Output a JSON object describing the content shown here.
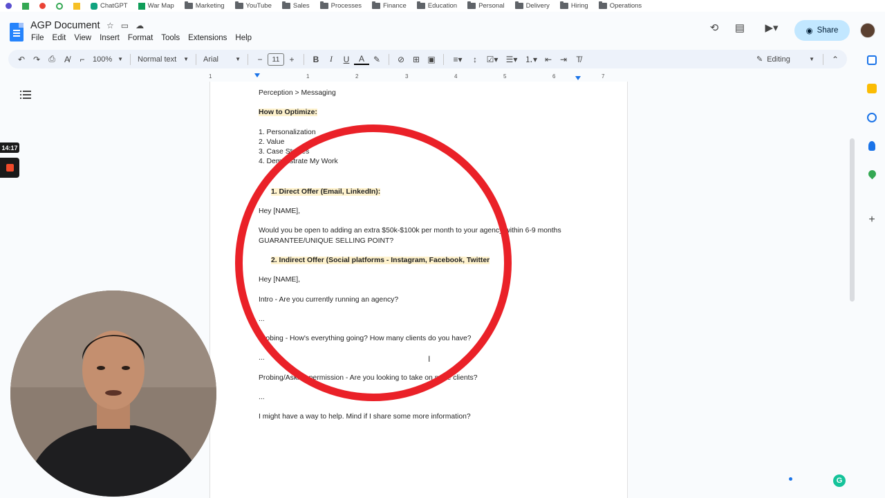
{
  "bookmarks": [
    "ChatGPT",
    "War Map",
    "Marketing",
    "YouTube",
    "Sales",
    "Processes",
    "Finance",
    "Education",
    "Personal",
    "Delivery",
    "Hiring",
    "Operations"
  ],
  "document": {
    "title": "AGP Document",
    "menus": [
      "File",
      "Edit",
      "View",
      "Insert",
      "Format",
      "Tools",
      "Extensions",
      "Help"
    ],
    "share_label": "Share"
  },
  "toolbar": {
    "zoom": "100%",
    "style": "Normal text",
    "font": "Arial",
    "font_size": "11",
    "mode": "Editing"
  },
  "ruler_labels": [
    "1",
    "1",
    "2",
    "3",
    "4",
    "5",
    "6",
    "7"
  ],
  "recording": {
    "timer": "14:17"
  },
  "body": {
    "line1": "Perception > Messaging",
    "how_heading": "How to Optimize:",
    "list": [
      "1. Personalization",
      "2. Value",
      "3. Case Studies",
      "4. Demonstrate My Work"
    ],
    "direct_heading": "1.   Direct Offer (Email, LinkedIn):",
    "hey1": "Hey [NAME],",
    "offer": "Would you be open to adding an extra $50k-$100k per month to your agency within 6-9 months",
    "guarantee": "GUARANTEE/UNIQUE SELLING POINT?",
    "indirect_heading": "2.   Indirect Offer (Social platforms - Instagram, Facebook, Twitter",
    "hey2": "Hey [NAME],",
    "intro": "Intro - Are you currently running an agency?",
    "ellipsis": "...",
    "probing": "Probing - How's everything going? How many clients do you have?",
    "permission": "Probing/Asking permission - Are you looking to take on more clients?",
    "help": "I might have a way to help. Mind if I share some more information?"
  },
  "colors": {
    "accent": "#c2e7ff",
    "highlight": "#fef2cd",
    "circle": "#ea2128",
    "docs_blue": "#2684fc"
  }
}
